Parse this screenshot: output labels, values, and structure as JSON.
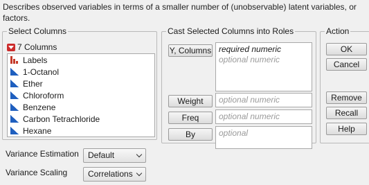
{
  "description": "Describes observed variables in terms of a smaller number of (unobservable) latent variables, or factors.",
  "select_columns": {
    "title": "Select Columns",
    "count_label": "7 Columns",
    "items": [
      {
        "label": "Labels",
        "icon": "nominal-bar-icon"
      },
      {
        "label": "1-Octanol",
        "icon": "continuous-icon"
      },
      {
        "label": "Ether",
        "icon": "continuous-icon"
      },
      {
        "label": "Chloroform",
        "icon": "continuous-icon"
      },
      {
        "label": "Benzene",
        "icon": "continuous-icon"
      },
      {
        "label": "Carbon Tetrachloride",
        "icon": "continuous-icon"
      },
      {
        "label": "Hexane",
        "icon": "continuous-icon"
      }
    ]
  },
  "cast_roles": {
    "title": "Cast Selected Columns into Roles",
    "y_columns": {
      "button": "Y, Columns",
      "required": "required numeric",
      "optional": "optional numeric"
    },
    "weight": {
      "button": "Weight",
      "placeholder": "optional numeric"
    },
    "freq": {
      "button": "Freq",
      "placeholder": "optional numeric"
    },
    "by": {
      "button": "By",
      "placeholder": "optional"
    }
  },
  "action": {
    "title": "Action",
    "ok": "OK",
    "cancel": "Cancel",
    "remove": "Remove",
    "recall": "Recall",
    "help": "Help"
  },
  "options": {
    "variance_estimation": {
      "label": "Variance Estimation",
      "value": "Default"
    },
    "variance_scaling": {
      "label": "Variance Scaling",
      "value": "Correlations"
    }
  },
  "colors": {
    "accent_red": "#cc2b2b",
    "continuous_blue": "#1f5fbf",
    "optional_gray": "#9a9a9a"
  }
}
